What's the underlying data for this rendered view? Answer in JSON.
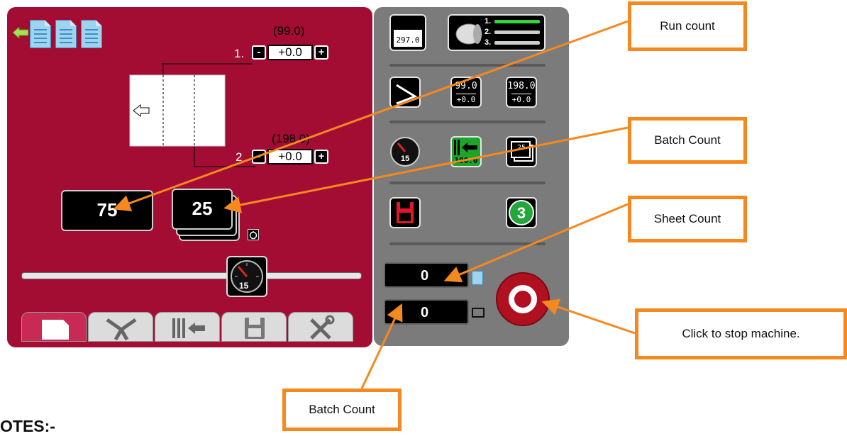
{
  "main": {
    "fold1": {
      "index": "1.",
      "preset": "(99.0)",
      "adjust": "+0.0"
    },
    "fold2": {
      "index": "2",
      "preset": "(198.0)",
      "adjust": "+0.0"
    },
    "minus_label": "-",
    "plus_label": "+",
    "run_count": "75",
    "batch_count": "25",
    "speed": "15"
  },
  "tabs": [
    "paper",
    "fold",
    "feed",
    "save",
    "tools"
  ],
  "side": {
    "paper_length": "297.0",
    "fold_list": [
      "1.",
      "2.",
      "3."
    ],
    "fold1": {
      "top": "99.0",
      "bottom": "+0.0"
    },
    "fold2": {
      "top": "198.0",
      "bottom": "+0.0"
    },
    "feed_value": "100.0",
    "batch_small": "25",
    "speed": "15",
    "program": "3",
    "sheet_count": "0",
    "batch_count": "0"
  },
  "annotations": {
    "run_count": "Run count",
    "batch_count_top": "Batch Count",
    "sheet_count": "Sheet Count",
    "stop": "Click to stop machine.",
    "batch_count_bottom": "Batch Count"
  },
  "notes": "OTES:-",
  "colors": {
    "panel_red": "#a30d34",
    "panel_grey": "#7b7b7b",
    "callout_orange": "#f5891f",
    "stop_red": "#b01020"
  },
  "icons": [
    "back-arrow-icon",
    "document-icon",
    "fold-icon",
    "feed-icon",
    "save-icon",
    "tools-icon",
    "gauge-icon",
    "stop-icon"
  ]
}
